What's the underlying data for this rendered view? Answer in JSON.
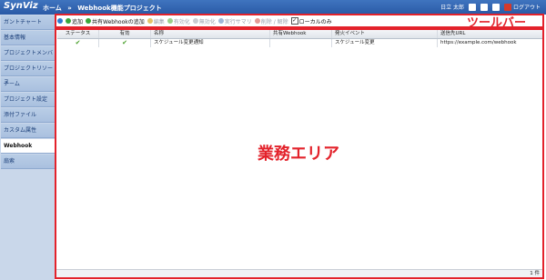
{
  "app": {
    "logo": "SynViz"
  },
  "breadcrumb": {
    "home": "ホーム",
    "separator": "»",
    "current": "Webhook機能プロジェクト"
  },
  "user": {
    "name": "日立 太郎",
    "logout": "ログアウト"
  },
  "sidebar": {
    "items": [
      {
        "label": "ガントチャート"
      },
      {
        "label": "基本情報"
      },
      {
        "label": "プロジェクトメンバ"
      },
      {
        "label": "プロジェクトリソース"
      },
      {
        "label": "チーム"
      },
      {
        "label": "プロジェクト設定"
      },
      {
        "label": "添付ファイル"
      },
      {
        "label": "カスタム属性"
      },
      {
        "label": "Webhook"
      },
      {
        "label": "扇索"
      }
    ]
  },
  "toolbar": {
    "add": "追加",
    "add_shared": "共有Webhookの追加",
    "edit": "編集",
    "enable": "有効化",
    "disable": "無効化",
    "summary": "実行サマリ",
    "delete": "削除 / 解除",
    "local_only": "ローカルのみ"
  },
  "annotations": {
    "toolbar": "ツールバー",
    "work_area": "業務エリア"
  },
  "table": {
    "headers": [
      "ステータス",
      "有効",
      "名称",
      "共有Webhook",
      "発火イベント",
      "送信先URL"
    ],
    "rows": [
      {
        "name": "スケジュール変更通知",
        "shared": "",
        "event": "スケジュール変更",
        "url": "https://example.com/webhook"
      }
    ]
  },
  "status": {
    "count": "1 件"
  },
  "colors": {
    "header": "#2a5aa6",
    "annotation": "#e3222b",
    "check": "#4aa02c"
  }
}
